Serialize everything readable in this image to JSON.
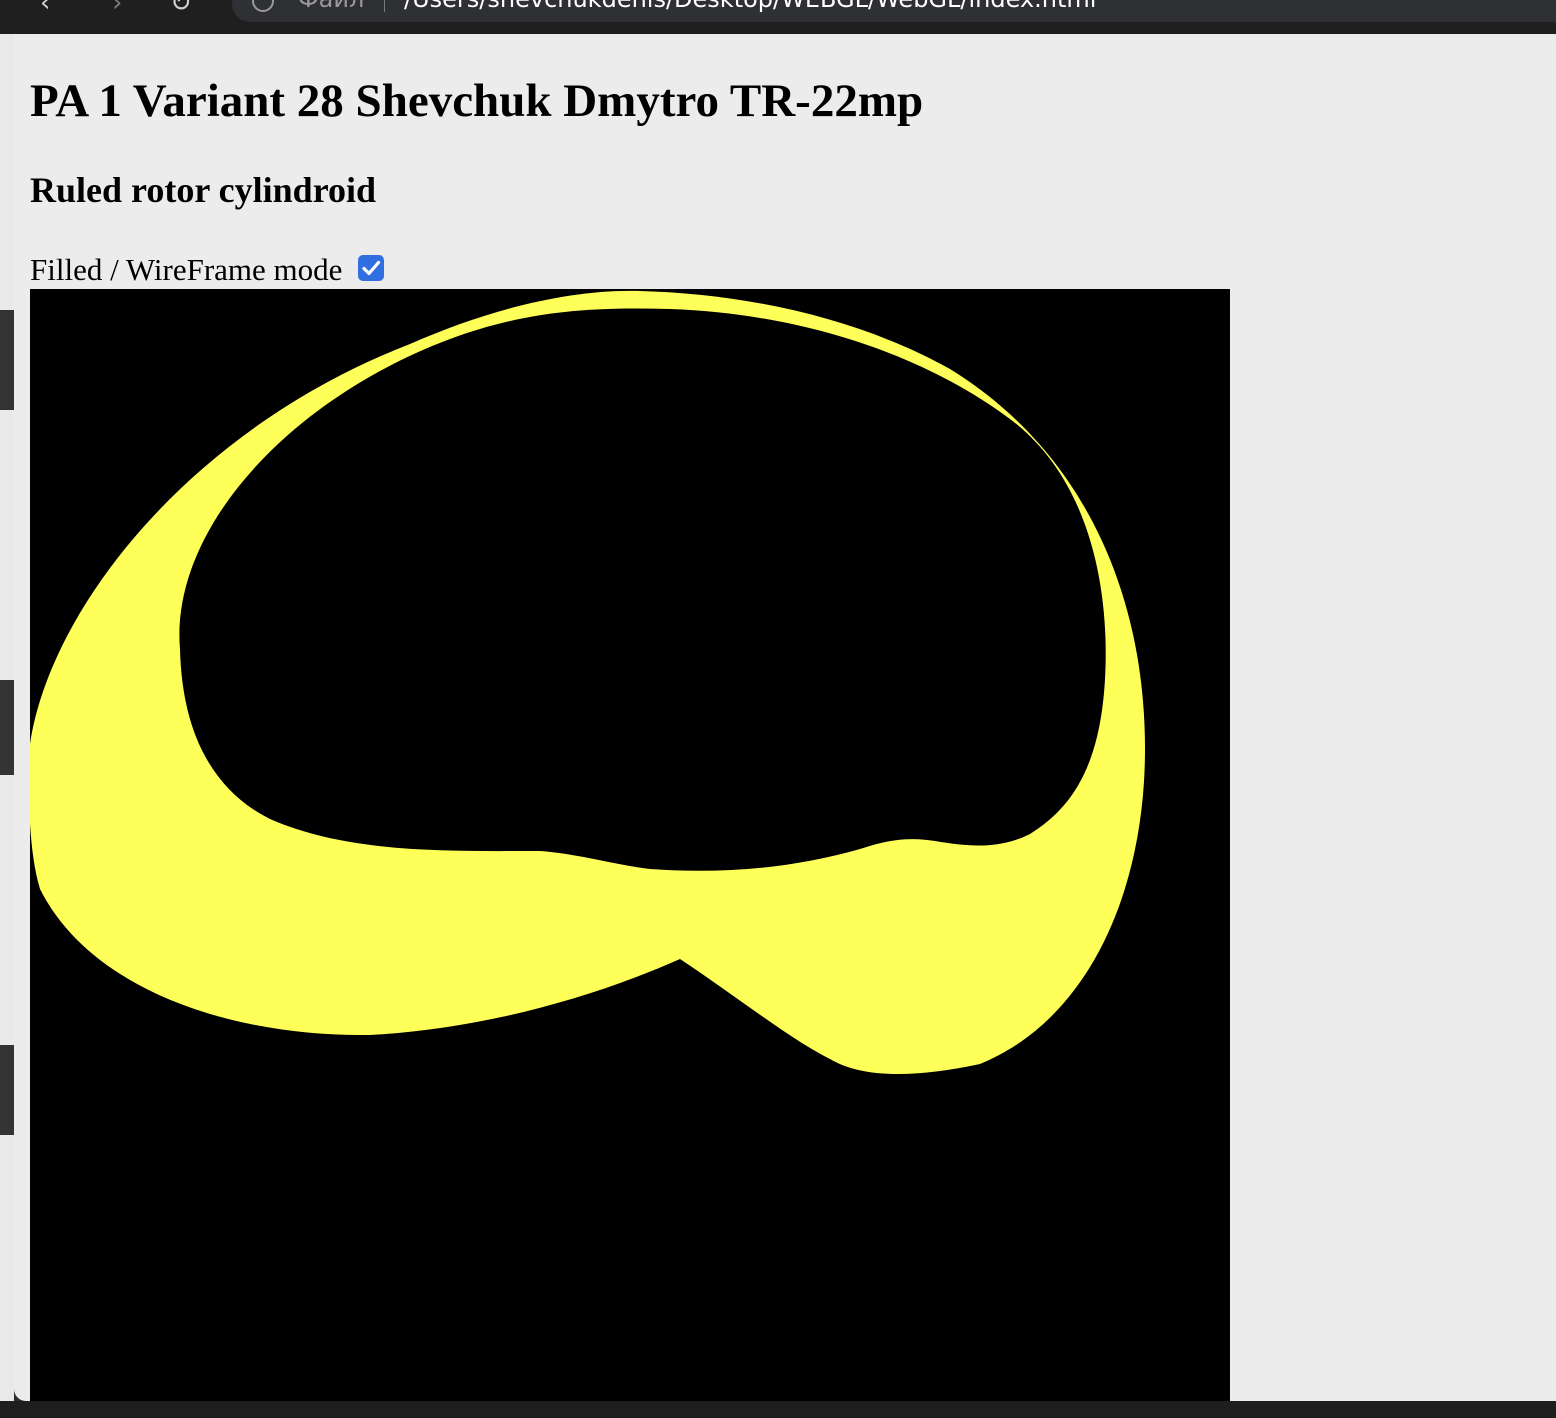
{
  "browser": {
    "scheme_label": "Файл",
    "url": "/Users/shevchukdenis/Desktop/WEBGL/WebGL/index.html"
  },
  "page": {
    "title": "PA 1 Variant 28 Shevchuk Dmytro TR-22mp",
    "subtitle": "Ruled rotor cylindroid",
    "mode_label": "Filled / WireFrame mode",
    "mode_checked": true
  },
  "canvas": {
    "background_color": "#000000",
    "surface_color": "#ffff59"
  }
}
